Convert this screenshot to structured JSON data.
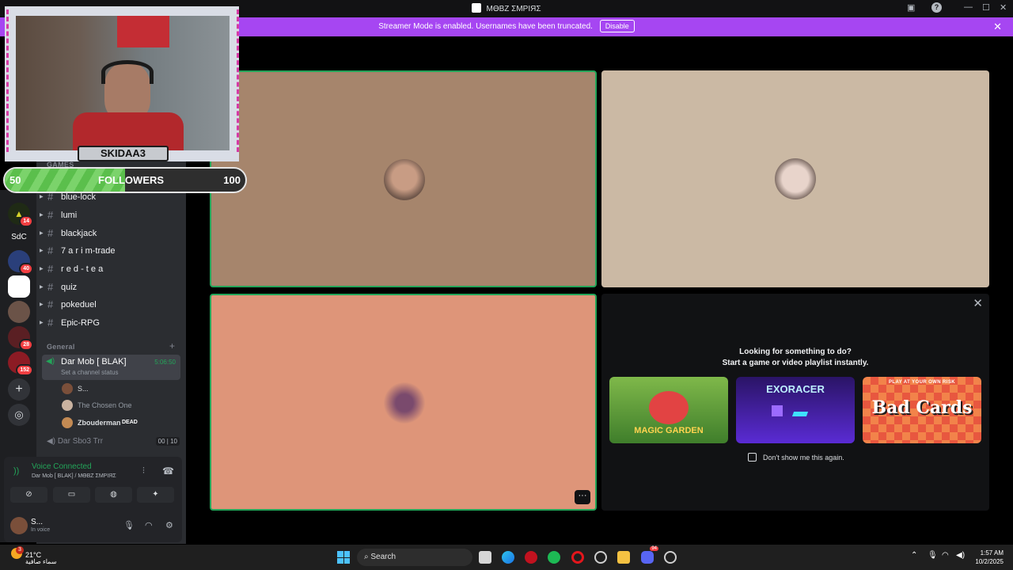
{
  "window": {
    "title": "MƟBZ ΣMPIЯΣ"
  },
  "banner": {
    "message": "Streamer Mode is enabled. Usernames have been truncated.",
    "disable_label": "Disable",
    "accent": "#a646f2"
  },
  "overlay": {
    "streamer_name": "SKIDAA3",
    "followers_label": "FOLLOWERS",
    "followers_current": "50",
    "followers_goal": "100"
  },
  "servers": [
    {
      "label": "",
      "badge": "14"
    },
    {
      "label": "SdC",
      "badge": ""
    },
    {
      "label": "",
      "badge": "40"
    },
    {
      "label": "",
      "badge": ""
    },
    {
      "label": "",
      "badge": ""
    },
    {
      "label": "",
      "badge": "28"
    },
    {
      "label": "",
      "badge": "152"
    }
  ],
  "sidebar": {
    "categories": {
      "games": "GAMES",
      "general": "General"
    },
    "channels": [
      {
        "name": "blue-lock"
      },
      {
        "name": "lumi"
      },
      {
        "name": "blackjack"
      },
      {
        "name": "7 a r i m-trade"
      },
      {
        "name": "r e d - t e a"
      },
      {
        "name": "quiz"
      },
      {
        "name": "pokeduel"
      },
      {
        "name": "Epic-RPG"
      }
    ],
    "voice_channel": {
      "name": "Dar Mob [ BLAK]",
      "time": "5:06:50",
      "status_placeholder": "Set a channel status",
      "users": [
        {
          "name": "S...",
          "tag": ""
        },
        {
          "name": "The Chosen One",
          "tag": ""
        },
        {
          "name": "Zbouderman",
          "tag": "DEAD"
        }
      ]
    },
    "voice_channel_2": {
      "name": "Dar Sbo3 Trr",
      "count_a": "00",
      "count_b": "10"
    }
  },
  "voice_panel": {
    "status": "Voice Connected",
    "location": "Dar Mob [ BLAK] / MƟBZ ΣMPIЯΣ",
    "user": {
      "name": "S...",
      "status": "In voice"
    }
  },
  "activity": {
    "title": "Looking for something to do?",
    "subtitle": "Start a game or video playlist instantly.",
    "games": [
      {
        "name": "MAGIC GARDEN"
      },
      {
        "name": "EXORACER"
      },
      {
        "name": "Bad Cards",
        "tagline": "PLAY AT YOUR OWN RISK"
      }
    ],
    "dont_show_label": "Don't show me this again."
  },
  "taskbar": {
    "weather_temp": "21°C",
    "weather_desc": "سماء صافية",
    "weather_badge": "3",
    "search_label": "Search",
    "time": "1:57 AM",
    "date": "10/2/2025",
    "discord_badge": "94"
  }
}
